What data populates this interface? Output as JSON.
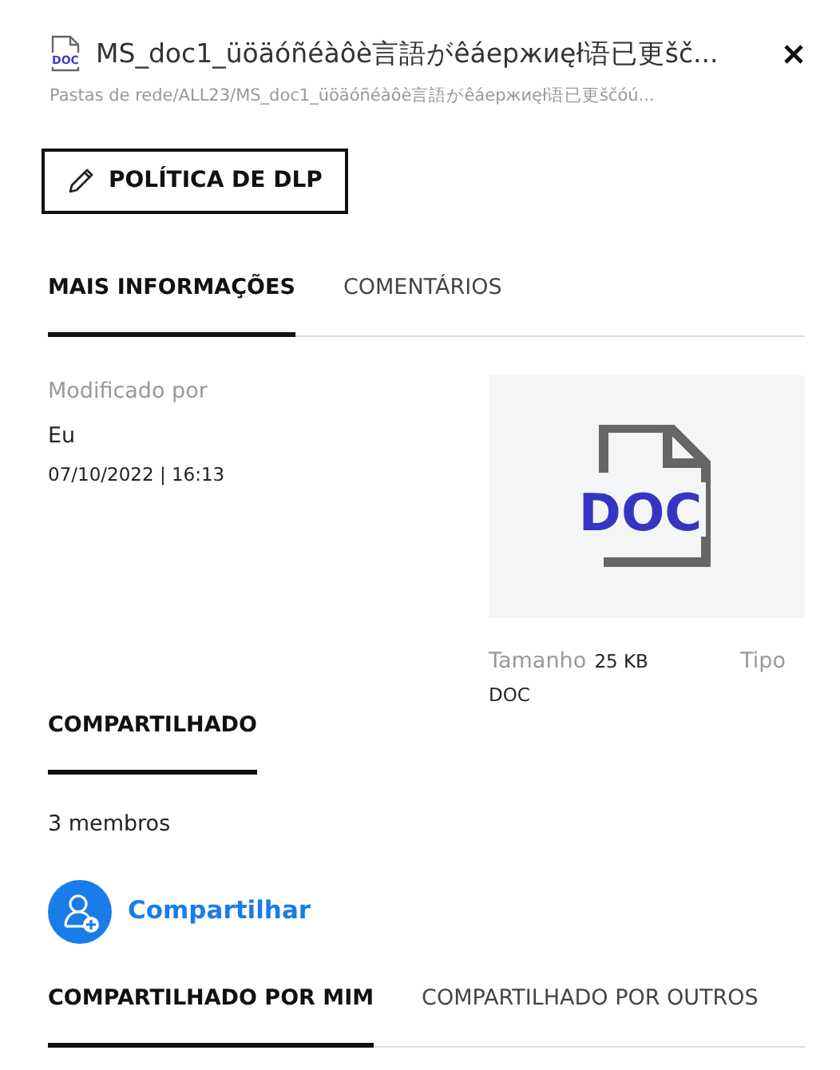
{
  "header": {
    "file_icon_label": "DOC",
    "title": "MS_doc1_üöäóñéàôè言語がêáержиęł语已更šč...",
    "path": "Pastas de rede/ALL23/MS_doc1_üöäóñéàôè言語がêáержиęł语已更ščóú..."
  },
  "dlp_button": {
    "label": "POLÍTICA DE DLP"
  },
  "tabs": [
    {
      "label": "MAIS INFORMAÇÕES",
      "selected": true
    },
    {
      "label": "COMENTÁRIOS",
      "selected": false
    }
  ],
  "details": {
    "modified_by_label": "Modificado por",
    "modified_by": "Eu",
    "modified_date": "07/10/2022 | 16:13",
    "thumbnail_label": "DOC",
    "size_label": "Tamanho",
    "size": "25 KB",
    "type_label": "Tipo",
    "type": "DOC"
  },
  "shared_tabs": [
    {
      "label": "COMPARTILHADO",
      "selected": true
    }
  ],
  "members": "3 membros",
  "share_button": {
    "label": "Compartilhar"
  },
  "share_tabs": [
    {
      "label": "COMPARTILHADO POR MIM",
      "selected": true
    },
    {
      "label": "COMPARTILHADO POR OUTROS",
      "selected": false
    }
  ]
}
